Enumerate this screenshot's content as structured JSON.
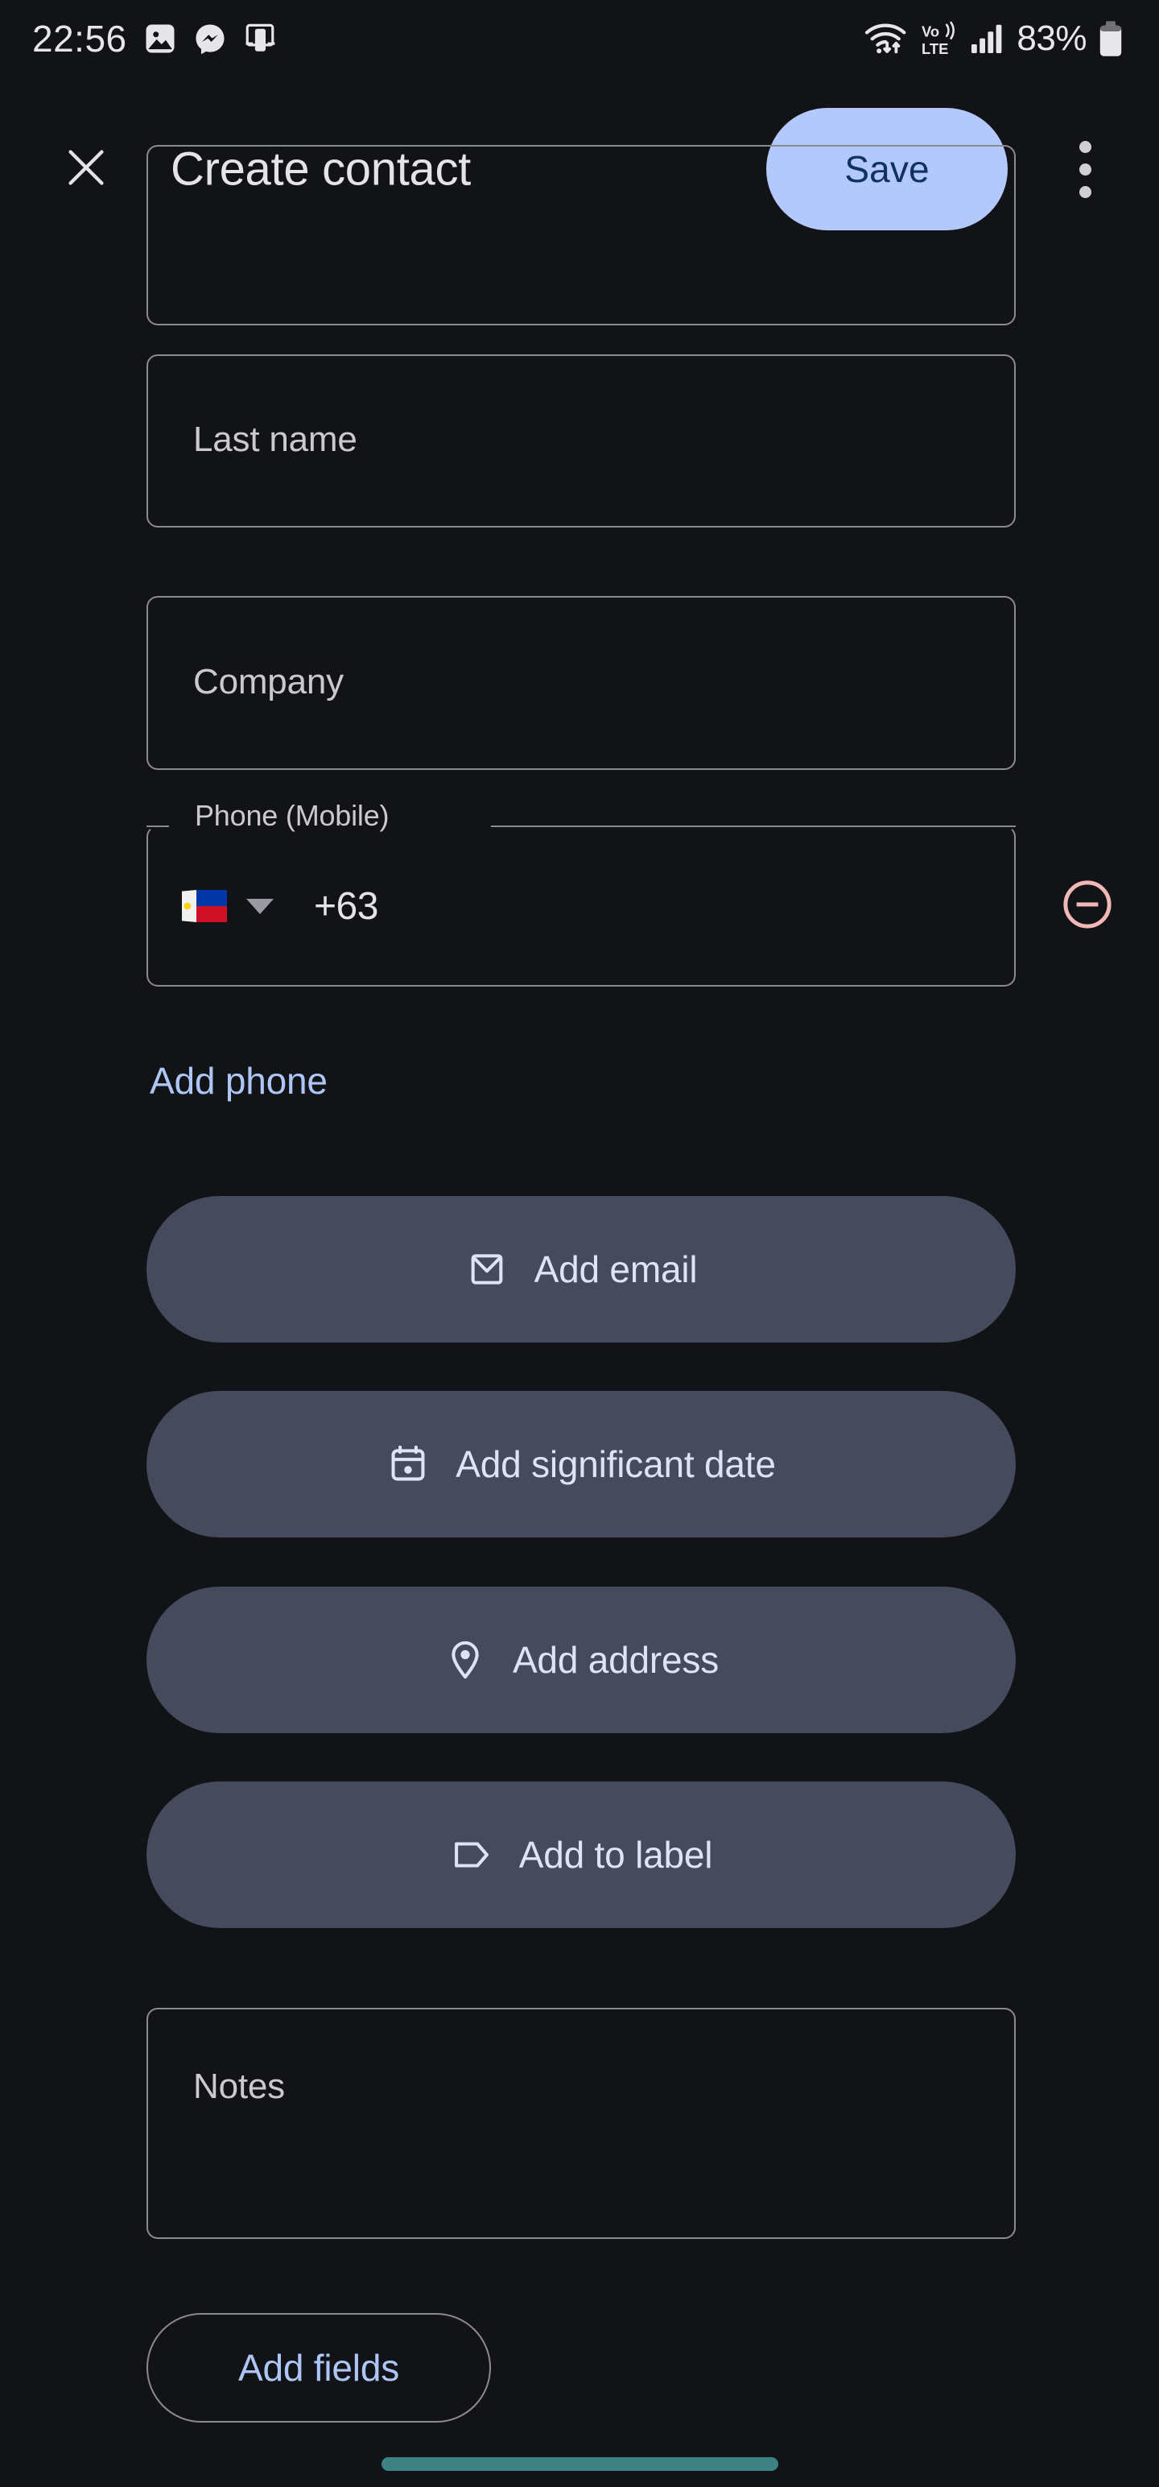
{
  "status_bar": {
    "time": "22:56",
    "left_icons": [
      "gallery-icon",
      "messenger-icon",
      "screen-mirror-icon"
    ],
    "wifi_icon": "wifi-data-icon",
    "volte_label_top": "Vo))",
    "volte_label_bottom": "LTE",
    "signal_icon": "cellular-signal-icon",
    "battery_percent": "83%",
    "battery_icon": "battery-icon"
  },
  "app_bar": {
    "close_icon": "close-icon",
    "title": "Create contact",
    "save_label": "Save",
    "overflow_icon": "more-vert-icon"
  },
  "form": {
    "fields": [
      {
        "id": "first",
        "placeholder": "",
        "clipped": true
      },
      {
        "id": "last",
        "placeholder": "Last name",
        "value": ""
      },
      {
        "id": "company",
        "placeholder": "Company",
        "value": ""
      }
    ],
    "phone": {
      "label": "Phone (Mobile)",
      "country_flag": "philippines-flag-icon",
      "dropdown_icon": "chevron-down-icon",
      "dial_code": "+63",
      "value": "",
      "remove_icon": "remove-circle-icon"
    },
    "add_phone_label": "Add phone",
    "action_buttons": [
      {
        "icon": "email-icon",
        "label": "Add email"
      },
      {
        "icon": "calendar-icon",
        "label": "Add significant date"
      },
      {
        "icon": "location-pin-icon",
        "label": "Add address"
      },
      {
        "icon": "label-tag-icon",
        "label": "Add to label"
      }
    ],
    "notes": {
      "placeholder": "Notes",
      "value": ""
    },
    "add_fields_label": "Add fields"
  },
  "nav_bar": {
    "home_indicator": "home-gesture-bar"
  },
  "colors": {
    "background": "#121316",
    "accent_blue": "#aec6f6",
    "save_button_bg": "#b3c9fc",
    "save_button_text": "#123163",
    "pill_bg": "#454a5c",
    "pill_text": "#dfe3f8",
    "field_border": "#8a8a91",
    "placeholder_text": "#c9c9cf",
    "remove_icon": "#f2b8b5",
    "nav_bar": "#3d8183"
  }
}
